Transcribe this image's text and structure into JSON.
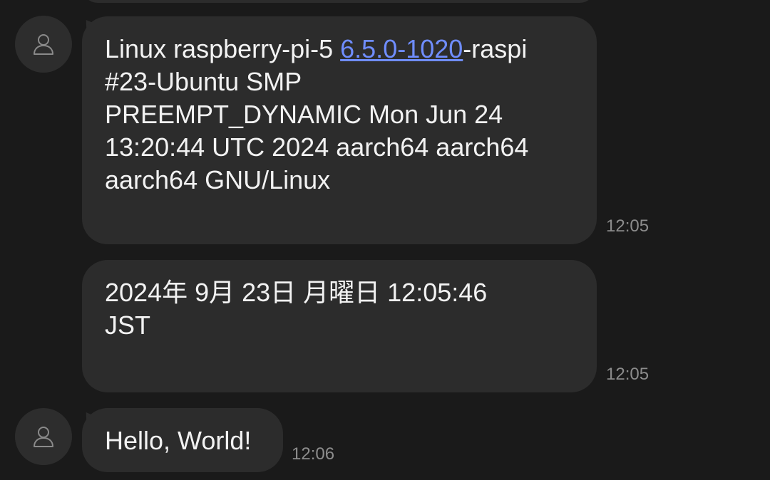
{
  "messages": [
    {
      "lines_before_link": "Linux raspberry-pi-5 ",
      "link_text": "6.5.0-1020",
      "after_link": "-raspi",
      "lines": [
        "#23-Ubuntu SMP",
        "PREEMPT_DYNAMIC Mon Jun 24",
        "13:20:44 UTC 2024 aarch64 aarch64",
        "aarch64 GNU/Linux"
      ],
      "time": "12:05"
    },
    {
      "lines": [
        "2024年  9月 23日 月曜日 12:05:46",
        "JST"
      ],
      "time": "12:05"
    },
    {
      "lines": [
        "Hello, World!"
      ],
      "time": "12:06"
    }
  ],
  "avatar_icon": "person-outline-icon",
  "colors": {
    "background": "#1a1a1a",
    "bubble": "#2c2c2c",
    "text": "#f2f2f2",
    "link": "#6f8dff",
    "timestamp": "#8c8c8c"
  }
}
